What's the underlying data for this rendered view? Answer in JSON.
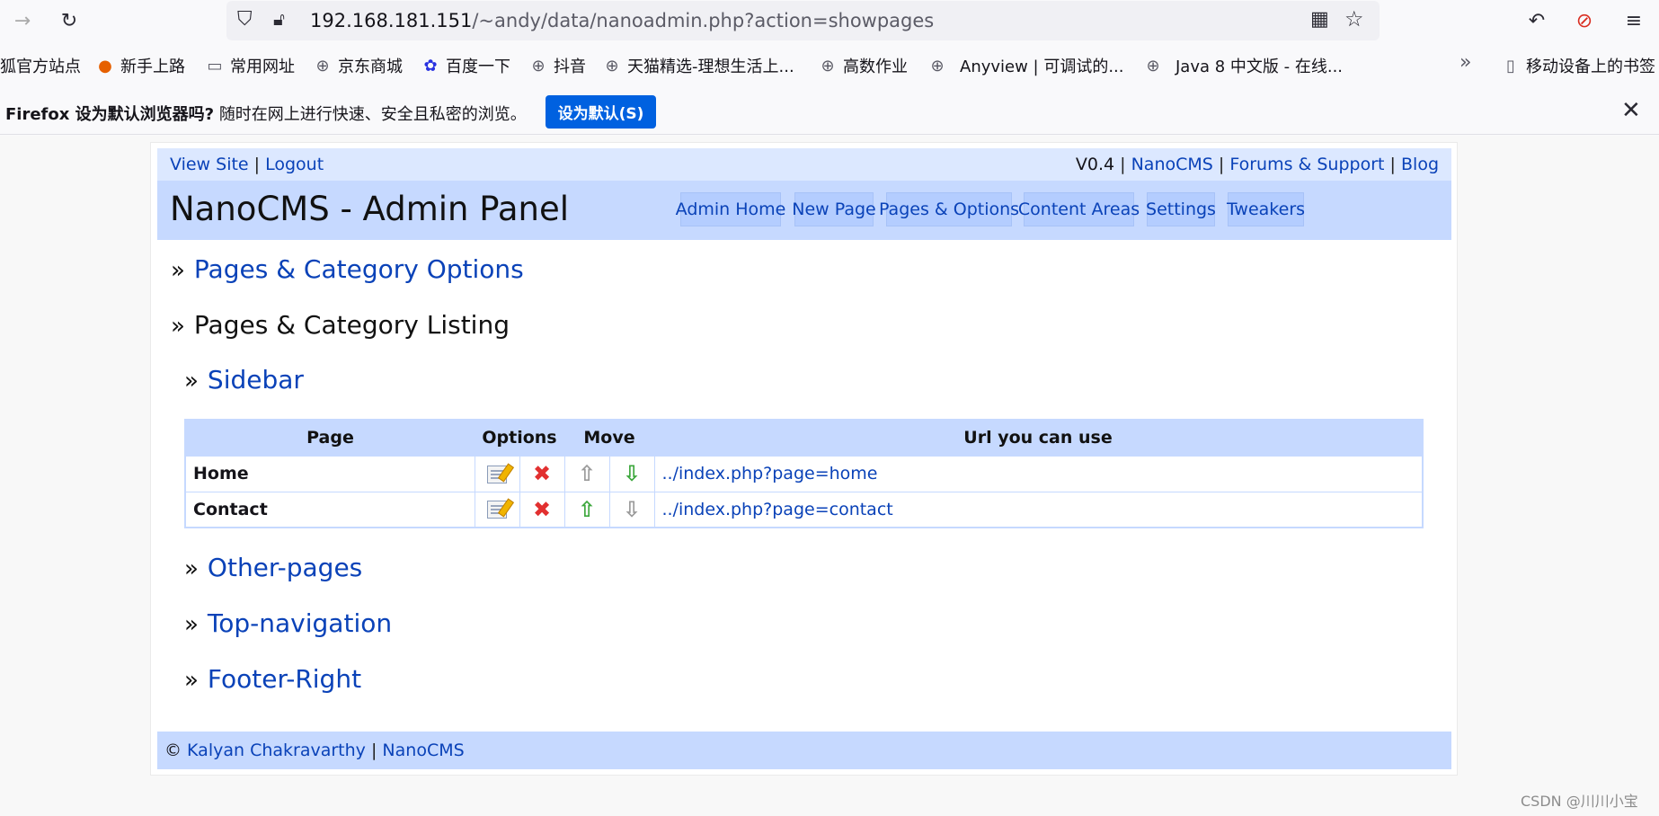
{
  "browser": {
    "url_host": "192.168.181.151",
    "url_path": "/~andy/data/nanoadmin.php?action=showpages",
    "bookmarks": [
      {
        "label": "狐官方站点",
        "icon": "none"
      },
      {
        "label": "新手上路",
        "icon": "firefox-icon"
      },
      {
        "label": "常用网址",
        "icon": "folder-icon"
      },
      {
        "label": "京东商城",
        "icon": "globe-icon"
      },
      {
        "label": "百度一下",
        "icon": "baidu-icon"
      },
      {
        "label": "抖音",
        "icon": "globe-icon"
      },
      {
        "label": "天猫精选-理想生活上...",
        "icon": "globe-icon"
      },
      {
        "label": "高数作业",
        "icon": "globe-icon"
      },
      {
        "label": "Anyview | 可调试的...",
        "icon": "globe-icon"
      },
      {
        "label": "Java 8 中文版 - 在线...",
        "icon": "globe-icon"
      }
    ],
    "bookmarks_overflow": "»",
    "mobile_bookmarks": "移动设备上的书签",
    "notification": {
      "bold": "Firefox 设为默认浏览器吗?",
      "text": "随时在网上进行快速、安全且私密的浏览。",
      "button": "设为默认(S)"
    }
  },
  "topbar": {
    "view_site": "View Site",
    "sep": "|",
    "logout": "Logout",
    "version": "V0.4",
    "nanocms": "NanoCMS",
    "forums": "Forums & Support",
    "blog": "Blog"
  },
  "header": {
    "title": "NanoCMS - Admin Panel",
    "nav": [
      {
        "label": "Admin Home"
      },
      {
        "label": "New Page"
      },
      {
        "label": "Pages & Options"
      },
      {
        "label": "Content Areas"
      },
      {
        "label": "Settings"
      },
      {
        "label": "Tweakers"
      }
    ]
  },
  "main": {
    "raquo": "»",
    "options_heading": "Pages & Category Options",
    "listing_heading": "Pages & Category Listing",
    "categories": [
      "Sidebar",
      "Other-pages",
      "Top-navigation",
      "Footer-Right"
    ],
    "table": {
      "headers": {
        "page": "Page",
        "options": "Options",
        "move": "Move",
        "url": "Url you can use"
      },
      "rows": [
        {
          "page": "Home",
          "url": "../index.php?page=home",
          "up_enabled": false,
          "down_enabled": true
        },
        {
          "page": "Contact",
          "url": "../index.php?page=contact",
          "up_enabled": true,
          "down_enabled": false
        }
      ]
    }
  },
  "footer": {
    "copyright": "©",
    "author": "Kalyan Chakravarthy",
    "sep": "|",
    "nanocms": "NanoCMS"
  },
  "watermark": "CSDN @川川小宝"
}
